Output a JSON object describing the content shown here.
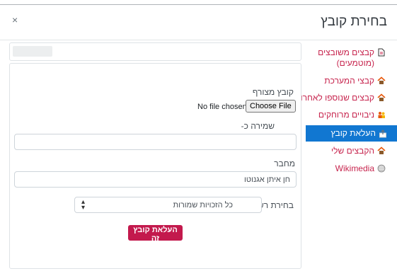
{
  "dialog": {
    "title": "בחירת קובץ",
    "close_glyph": "×"
  },
  "sidebar": {
    "items": [
      {
        "label": "קבצים משובצים (מוטמעים)",
        "icon": "file-icon",
        "active": false
      },
      {
        "label": "קבצי המערכת",
        "icon": "house-icon",
        "active": false
      },
      {
        "label": "קבצים שנוספו לאחרונה",
        "icon": "house-icon",
        "active": false
      },
      {
        "label": "ניבויים מרוחקים",
        "icon": "people-icon",
        "active": false
      },
      {
        "label": "העלאת קובץ",
        "icon": "upload-icon",
        "active": true
      },
      {
        "label": "הקבצים שלי",
        "icon": "house-icon",
        "active": false
      },
      {
        "label": "Wikimedia",
        "icon": "globe-icon",
        "active": false
      }
    ]
  },
  "form": {
    "attachment_label": "קובץ מצורף",
    "no_file": "No file chosen",
    "choose_button": "Choose File",
    "save_as_label": "שמירה כ-",
    "save_as_value": "",
    "author_label": "מחבר",
    "author_value": "חן איתן אגנוטו",
    "license_label": "בחירת רשיון",
    "license_value": "כל הזכויות שמורות",
    "upload_button": "העלאת קובץ זה"
  },
  "colors": {
    "link": "#c7254e",
    "active_bg": "#1177d1",
    "primary_button": "#c3194d"
  }
}
